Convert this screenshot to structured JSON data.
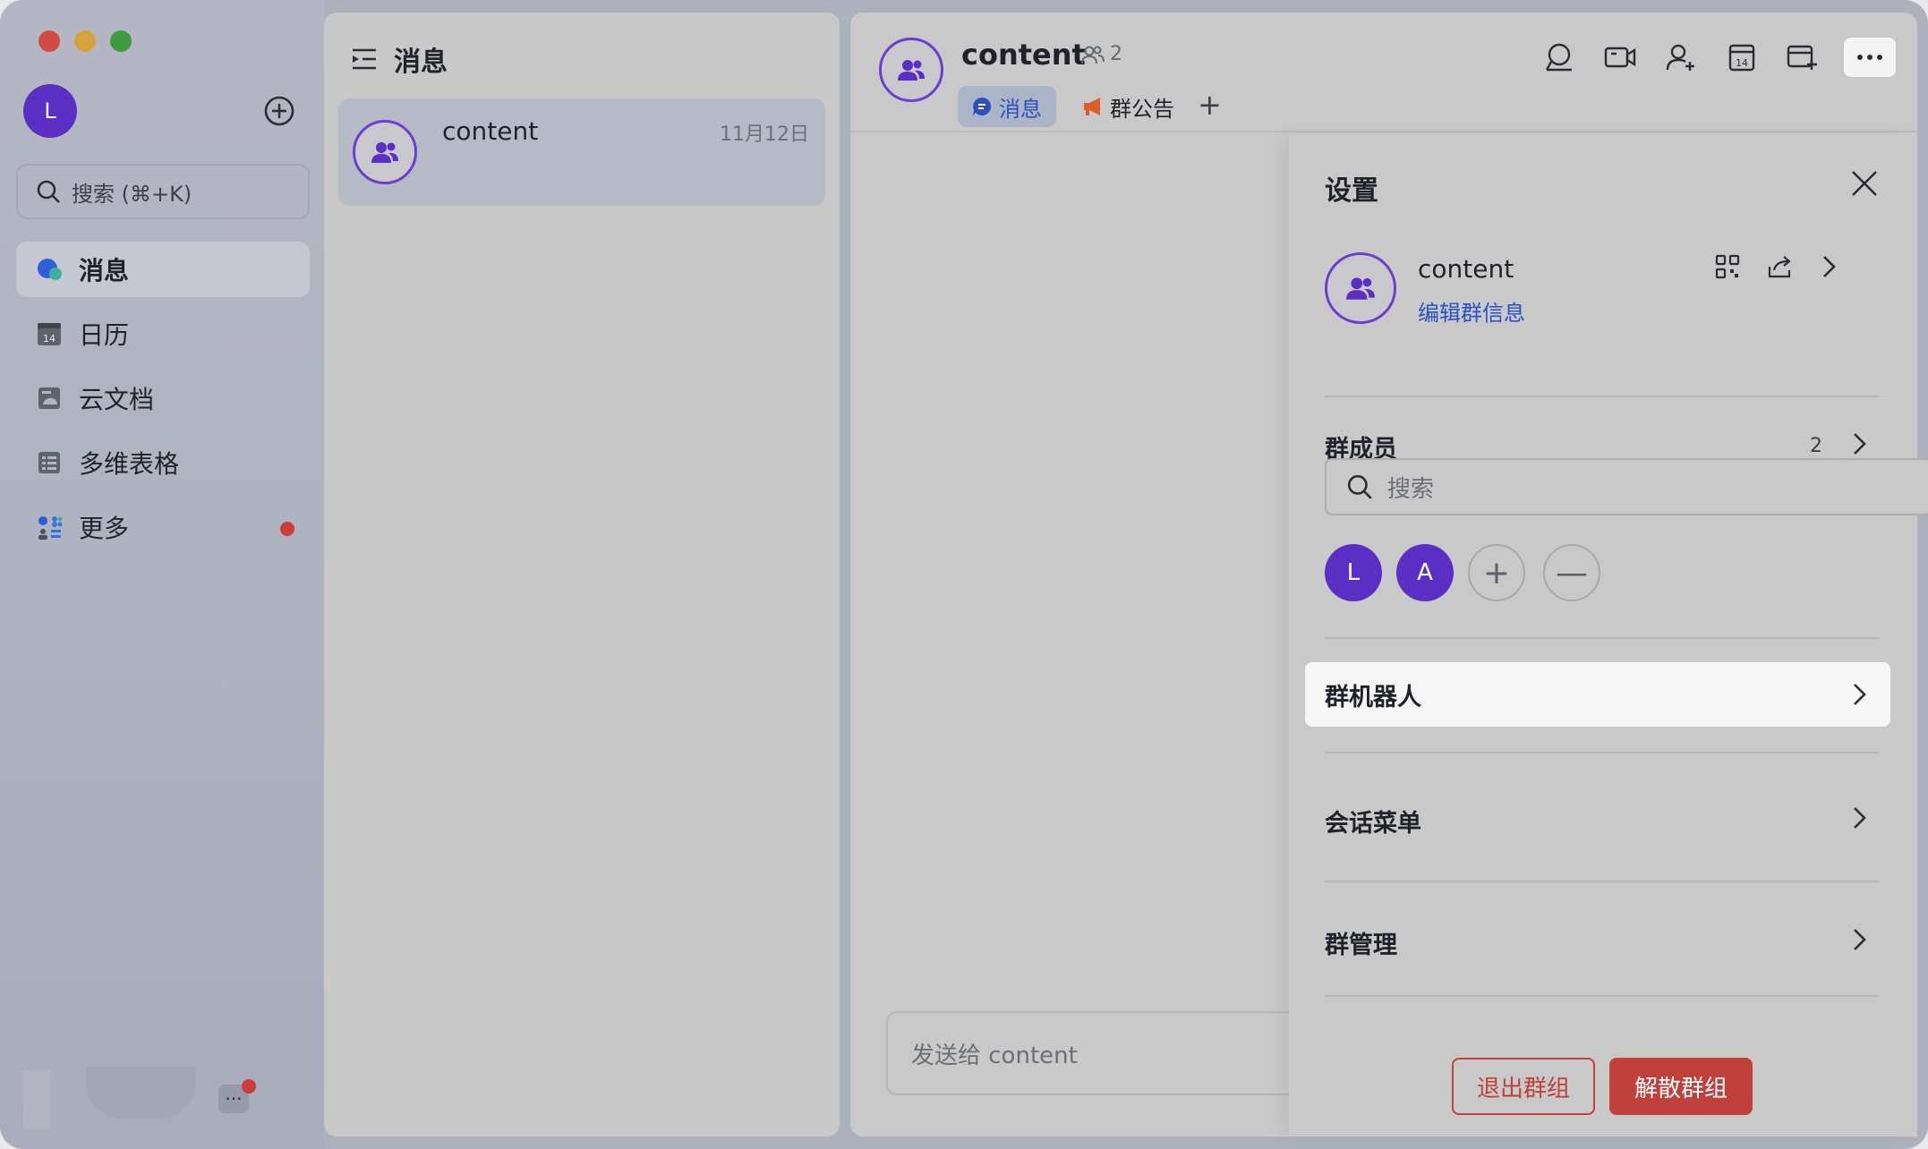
{
  "sidebar": {
    "avatar_initial": "L",
    "search_placeholder": "搜索 (⌘+K)",
    "items": [
      {
        "label": "消息",
        "icon": "chat-bubble-icon",
        "active": true
      },
      {
        "label": "日历",
        "icon": "calendar-icon"
      },
      {
        "label": "云文档",
        "icon": "cloud-doc-icon"
      },
      {
        "label": "多维表格",
        "icon": "table-icon"
      },
      {
        "label": "更多",
        "icon": "apps-grid-icon",
        "badge": true
      }
    ],
    "bottom_more": "···"
  },
  "conversations": {
    "header": "消息",
    "items": [
      {
        "name": "content",
        "date": "11月12日"
      }
    ]
  },
  "chat": {
    "title": "content",
    "member_count": "2",
    "tabs": [
      {
        "label": "消息",
        "active": true
      },
      {
        "label": "群公告"
      }
    ],
    "tab_add": "+",
    "input_placeholder": "发送给 content"
  },
  "settings": {
    "title": "设置",
    "group_name": "content",
    "edit_label": "编辑群信息",
    "members_label": "群成员",
    "members_count": "2",
    "member_search_placeholder": "搜索",
    "members": [
      "L",
      "A"
    ],
    "add_symbol": "+",
    "remove_symbol": "—",
    "bots_label": "群机器人",
    "chat_menu_label": "会话菜单",
    "group_manage_label": "群管理",
    "leave_button": "退出群组",
    "disband_button": "解散群组"
  },
  "colors": {
    "accent_purple": "#5b2fc4",
    "link_blue": "#2851c5",
    "danger_red": "#c0403b"
  }
}
